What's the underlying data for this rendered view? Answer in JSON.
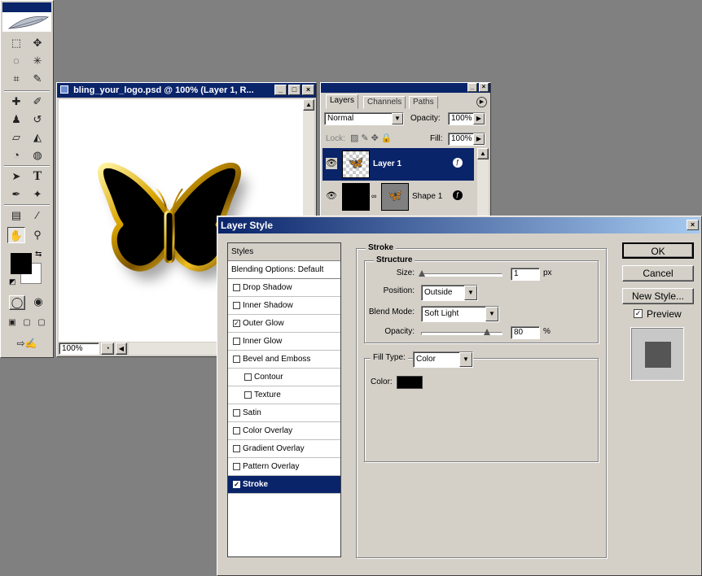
{
  "document": {
    "title": "bling_your_logo.psd @ 100% (Layer 1, R...",
    "zoom": "100%"
  },
  "layers_palette": {
    "tabs": [
      "Layers",
      "Channels",
      "Paths"
    ],
    "blend_mode": "Normal",
    "opacity_label": "Opacity:",
    "opacity_value": "100%",
    "lock_label": "Lock:",
    "fill_label": "Fill:",
    "fill_value": "100%",
    "layers": [
      {
        "name": "Layer 1",
        "selected": true
      },
      {
        "name": "Shape 1",
        "selected": false
      }
    ]
  },
  "dialog": {
    "title": "Layer Style",
    "styles_header": "Styles",
    "blending_options": "Blending Options: Default",
    "style_items": [
      {
        "label": "Drop Shadow",
        "checked": false,
        "sub": false
      },
      {
        "label": "Inner Shadow",
        "checked": false,
        "sub": false
      },
      {
        "label": "Outer Glow",
        "checked": true,
        "sub": false
      },
      {
        "label": "Inner Glow",
        "checked": false,
        "sub": false
      },
      {
        "label": "Bevel and Emboss",
        "checked": false,
        "sub": false
      },
      {
        "label": "Contour",
        "checked": false,
        "sub": true
      },
      {
        "label": "Texture",
        "checked": false,
        "sub": true
      },
      {
        "label": "Satin",
        "checked": false,
        "sub": false
      },
      {
        "label": "Color Overlay",
        "checked": false,
        "sub": false
      },
      {
        "label": "Gradient Overlay",
        "checked": false,
        "sub": false
      },
      {
        "label": "Pattern Overlay",
        "checked": false,
        "sub": false
      },
      {
        "label": "Stroke",
        "checked": true,
        "sub": false,
        "selected": true
      }
    ],
    "stroke": {
      "group_title": "Stroke",
      "structure_title": "Structure",
      "size_label": "Size:",
      "size_value": "1",
      "size_unit": "px",
      "position_label": "Position:",
      "position_value": "Outside",
      "blend_mode_label": "Blend Mode:",
      "blend_mode_value": "Soft Light",
      "opacity_label": "Opacity:",
      "opacity_value": "80",
      "opacity_unit": "%",
      "opacity_level": 0.8,
      "size_level": 0.0,
      "fill_type_label": "Fill Type:",
      "fill_type_value": "Color",
      "color_label": "Color:",
      "color_value": "#000000"
    },
    "buttons": {
      "ok": "OK",
      "cancel": "Cancel",
      "new_style": "New Style...",
      "preview": "Preview"
    },
    "preview_checked": true
  }
}
